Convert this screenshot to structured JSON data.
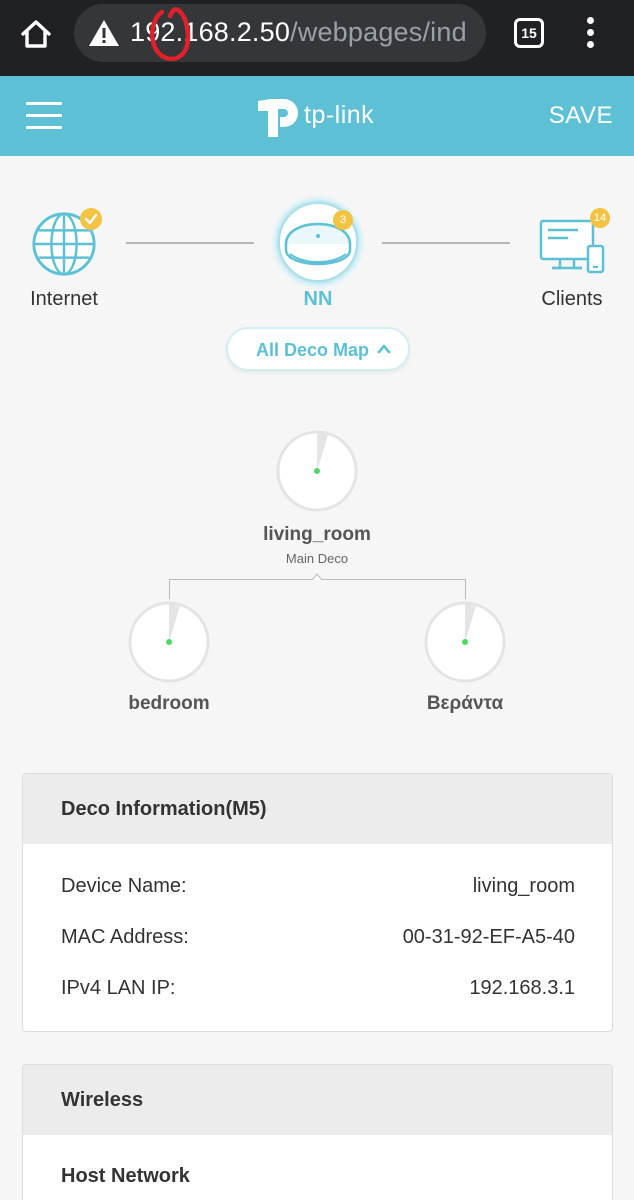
{
  "browser": {
    "url_host": "192.168.2.50",
    "url_path": "/webpages/ind",
    "tab_count": "15"
  },
  "header": {
    "logo_text": "tp-link",
    "save_label": "SAVE"
  },
  "topology": {
    "internet_label": "Internet",
    "network_name": "NN",
    "deco_count_badge": "3",
    "clients_label": "Clients",
    "clients_count_badge": "14",
    "map_button_label": "All Deco Map"
  },
  "mesh": {
    "main": {
      "name": "living_room",
      "role": "Main Deco"
    },
    "satellites": [
      {
        "name": "bedroom"
      },
      {
        "name": "Βεράντα"
      }
    ]
  },
  "deco_info": {
    "title": "Deco Information(M5)",
    "rows": [
      {
        "label": "Device Name:",
        "value": "living_room"
      },
      {
        "label": "MAC Address:",
        "value": "00-31-92-EF-A5-40"
      },
      {
        "label": "IPv4 LAN IP:",
        "value": "192.168.3.1"
      }
    ]
  },
  "wireless": {
    "title": "Wireless",
    "subheading": "Host Network"
  },
  "colors": {
    "accent": "#5ec0d5",
    "badge": "#f5c342",
    "status_online": "#4cd964",
    "annotation": "#e0202a"
  }
}
